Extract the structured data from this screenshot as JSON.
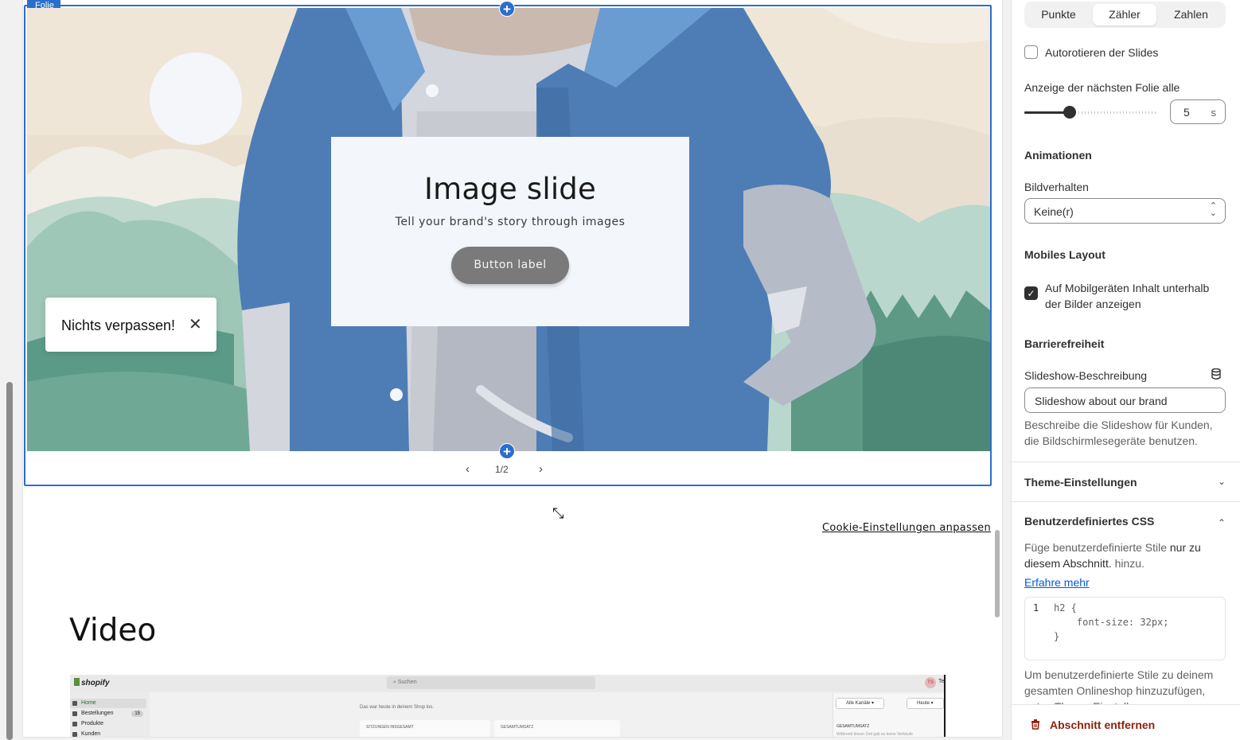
{
  "preview": {
    "slide_tag": "Folie",
    "slide": {
      "heading": "Image slide",
      "text": "Tell your brand's story through images",
      "button_label": "Button label"
    },
    "popup": {
      "text": "Nichts verpassen!",
      "close_glyph": "✕"
    },
    "nav": {
      "prev_glyph": "‹",
      "counter": "1/2",
      "next_glyph": "›"
    },
    "cookie_link": "Cookie-Einstellungen anpassen",
    "video_heading": "Video",
    "video_thumb": {
      "logo": "shopify",
      "search_placeholder": "Suchen",
      "avatar": "TS",
      "avatar_text": "Te",
      "nav": [
        {
          "label": "Home",
          "badge": ""
        },
        {
          "label": "Bestellungen",
          "badge": "15"
        },
        {
          "label": "Produkte",
          "badge": ""
        },
        {
          "label": "Kunden",
          "badge": ""
        }
      ],
      "headline": "Das war heute in deinem Shop los.",
      "card_sessions": "SITZUNGEN INSGESAMT",
      "card_revenue": "GESAMTUMSATZ",
      "btn_channels": "Alle Kanäle ▾",
      "btn_today": "Heute ▾",
      "total_label": "GESAMTUMSATZ",
      "total_sub": "Während dieser Zeit gab es keine Verkäufe"
    }
  },
  "settings": {
    "pagination_tabs": [
      {
        "label": "Punkte",
        "active": false
      },
      {
        "label": "Zähler",
        "active": true
      },
      {
        "label": "Zahlen",
        "active": false
      }
    ],
    "autorotate_label": "Autorotieren der Slides",
    "autorotate_checked": false,
    "interval_label": "Anzeige der nächsten Folie alle",
    "interval_value": "5",
    "interval_unit": "s",
    "interval_fraction": 0.15,
    "animations_title": "Animationen",
    "image_behavior_label": "Bildverhalten",
    "image_behavior_value": "Keine(r)",
    "mobile_title": "Mobiles Layout",
    "mobile_label_line1": "Auf Mobilgeräten Inhalt unterhalb",
    "mobile_label_line2": "der Bilder anzeigen",
    "mobile_checked": true,
    "a11y_title": "Barrierefreiheit",
    "slideshow_desc_label": "Slideshow-Beschreibung",
    "slideshow_desc_value": "Slideshow about our brand",
    "slideshow_desc_help_line1": "Beschreibe die Slideshow für Kunden,",
    "slideshow_desc_help_line2": "die Bildschirmlesegeräte benutzen.",
    "theme_settings_title": "Theme-Einstellungen",
    "custom_css_title": "Benutzerdefiniertes CSS",
    "custom_css_help_a": "Füge benutzerdefinierte Stile",
    "custom_css_help_b": "nur zu",
    "custom_css_help_c": "diesem Abschnitt.",
    "custom_css_help_d": "hinzu.",
    "learn_more": "Erfahre mehr",
    "code_line_number": "1",
    "code_lines": [
      "h2 {",
      "    font-size: 32px;",
      "}"
    ],
    "global_css_help_line1": "Um benutzerdefinierte Stile zu deinem",
    "global_css_help_line2": "gesamten Onlineshop hinzuzufügen,",
    "global_css_help_line3": "nutze Theme-Einstellungen",
    "remove_section": "Abschnitt entfernen"
  },
  "colors": {
    "accent": "#2c6ecb",
    "danger": "#8e1f0b",
    "link": "#005bd3",
    "slide_button": "#7a7a7a"
  }
}
